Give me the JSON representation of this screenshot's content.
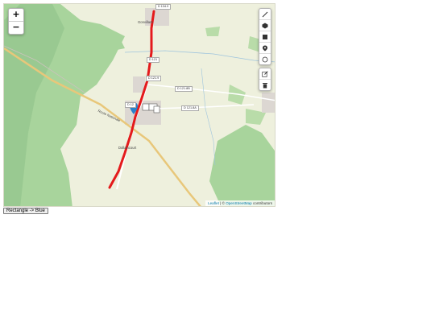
{
  "map": {
    "zoom_in": "+",
    "zoom_out": "−",
    "draw_tools": [
      {
        "name": "draw-polyline-button",
        "icon": "polyline-icon",
        "glyph": "⟋"
      },
      {
        "name": "draw-polygon-button",
        "icon": "polygon-icon",
        "glyph": "⬢"
      },
      {
        "name": "draw-rectangle-button",
        "icon": "rectangle-icon",
        "glyph": "■"
      },
      {
        "name": "draw-marker-button",
        "icon": "marker-icon",
        "glyph": "●"
      },
      {
        "name": "draw-circle-button",
        "icon": "circle-icon",
        "glyph": "○"
      }
    ],
    "edit_tools": [
      {
        "name": "edit-layers-button",
        "icon": "edit-icon"
      },
      {
        "name": "delete-layers-button",
        "icon": "trash-icon"
      }
    ],
    "road_labels": [
      "D 134.9",
      "D 121",
      "D 121.9",
      "D 121.8B",
      "D 121.8A",
      "D 12"
    ],
    "place_labels": [
      "Gonvillars",
      "Dollaincourt",
      "Route Nationale"
    ],
    "attribution": {
      "leaflet": "Leaflet",
      "separator": " | © ",
      "osm": "OpenStreetMap",
      "suffix": " contributors"
    },
    "colors": {
      "route": "#e41a1c",
      "marker": "#2a81cb",
      "forest": "#8fc28a",
      "background": "#efefe0"
    }
  },
  "controls": {
    "toggle_button": "Rectangle -> Blue"
  }
}
